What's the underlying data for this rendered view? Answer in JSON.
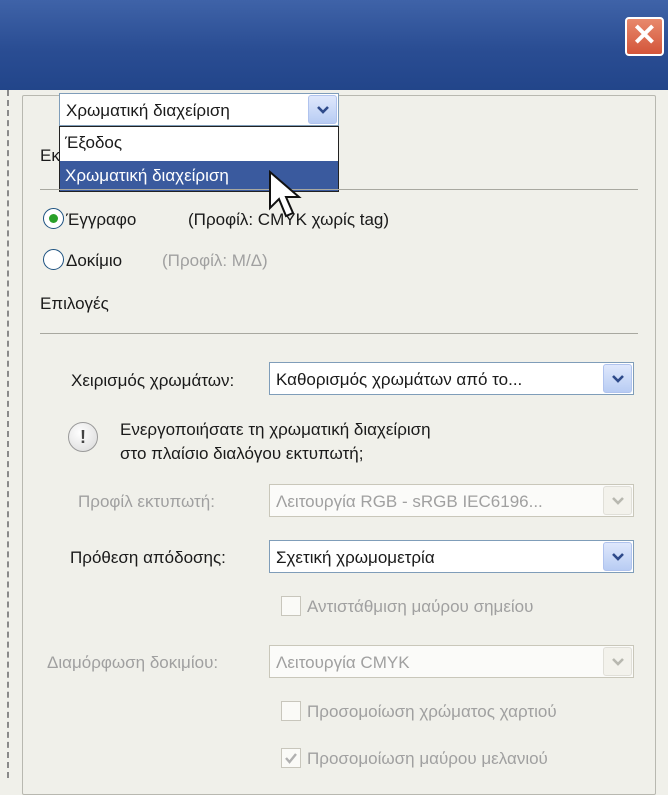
{
  "dialog": {
    "close_icon": "close-x-icon",
    "close_glyph": "✕"
  },
  "source_combo": {
    "value": "Χρωματική διαχείριση",
    "options": [
      "Έξοδος",
      "Χρωματική διαχείριση"
    ],
    "selected_index": 1
  },
  "partial_label": "Εκ",
  "print_section": {
    "document_label": "Έγγραφο",
    "document_profile": "(Προφίλ: CMYK χωρίς tag)",
    "proof_label": "Δοκίμιο",
    "proof_profile": "(Προφίλ: Μ/Δ)",
    "document_checked": true
  },
  "options_heading": "Επιλογές",
  "color_handling": {
    "label": "Χειρισμός χρωμάτων:",
    "value": "Καθορισμός χρωμάτων από το..."
  },
  "notice": {
    "icon": "info-icon",
    "glyph": "!",
    "line1": "Ενεργοποιήσατε τη χρωματική διαχείριση",
    "line2": "στο πλαίσιο διαλόγου εκτυπωτή;"
  },
  "printer_profile": {
    "label": "Προφίλ εκτυπωτή:",
    "value": "Λειτουργία RGB - sRGB IEC6196..."
  },
  "rendering_intent": {
    "label": "Πρόθεση απόδοσης:",
    "value": "Σχετική χρωμομετρία"
  },
  "black_point": {
    "label": "Αντιστάθμιση μαύρου σημείου",
    "checked": false
  },
  "proof_setup": {
    "label": "Διαμόρφωση δοκιμίου:",
    "value": "Λειτουργία CMYK"
  },
  "simulate_paper": {
    "label": "Προσομοίωση χρώματος χαρτιού",
    "checked": false
  },
  "simulate_ink": {
    "label": "Προσομοίωση μαύρου μελανιού",
    "checked": true
  },
  "colors": {
    "titlebar": "#2a4d93",
    "selection": "#3a5a9e",
    "radio_dot": "#2aa02a",
    "disabled_text": "#a0a0a0"
  }
}
